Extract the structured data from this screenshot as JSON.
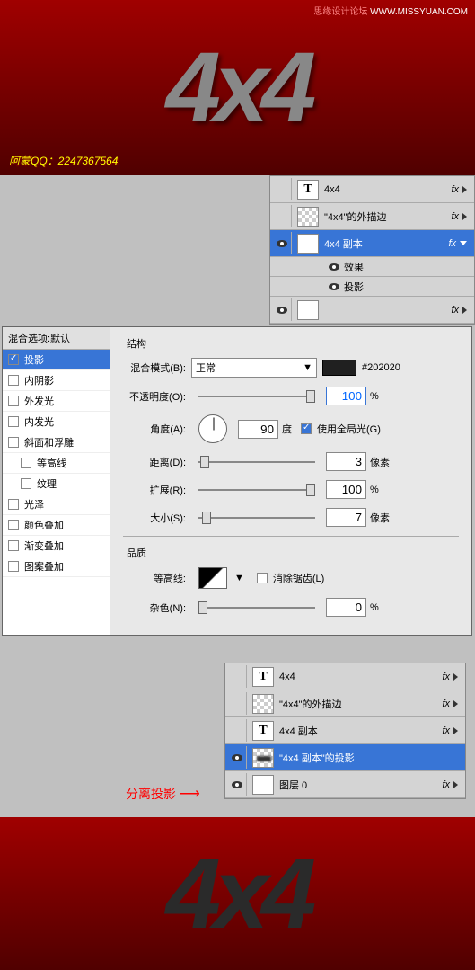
{
  "watermark": {
    "site1": "思缘设计论坛",
    "site2": "WWW.MISSYUAN.COM"
  },
  "qq": "阿蒙QQ：2247367564",
  "banner_text": "4x4",
  "layers_top": {
    "items": [
      {
        "name": "4x4",
        "type": "T",
        "fx": "fx"
      },
      {
        "name": "\"4x4\"的外描边",
        "type": "checker",
        "fx": "fx"
      },
      {
        "name": "4x4 副本",
        "type": "T",
        "fx": "fx",
        "selected": true,
        "visible": true
      },
      {
        "name": "效果",
        "sub": true,
        "visible": true
      },
      {
        "name": "投影",
        "sub": true,
        "visible": true
      },
      {
        "name": "",
        "type": "white",
        "fx": "fx",
        "visible": true
      }
    ]
  },
  "dialog": {
    "list_header": "混合选项:默认",
    "options": [
      "投影",
      "内阴影",
      "外发光",
      "内发光",
      "斜面和浮雕",
      "等高线",
      "纹理",
      "光泽",
      "颜色叠加",
      "渐变叠加",
      "图案叠加"
    ],
    "active_option": "投影",
    "section_structure": "结构",
    "blend_mode_label": "混合模式(B):",
    "blend_mode_value": "正常",
    "color_hex": "#202020",
    "opacity_label": "不透明度(O):",
    "opacity_value": "100",
    "angle_label": "角度(A):",
    "angle_value": "90",
    "angle_unit": "度",
    "global_light": "使用全局光(G)",
    "distance_label": "距离(D):",
    "distance_value": "3",
    "distance_unit": "像素",
    "spread_label": "扩展(R):",
    "spread_value": "100",
    "spread_unit": "%",
    "size_label": "大小(S):",
    "size_value": "7",
    "size_unit": "像素",
    "section_quality": "品质",
    "contour_label": "等高线:",
    "antialias": "消除锯齿(L)",
    "noise_label": "杂色(N):",
    "noise_value": "0",
    "noise_unit": "%",
    "percent": "%"
  },
  "annotation_text": "分离投影",
  "layers_bottom": {
    "items": [
      {
        "name": "4x4",
        "type": "T",
        "fx": "fx"
      },
      {
        "name": "\"4x4\"的外描边",
        "type": "checker",
        "fx": "fx"
      },
      {
        "name": "4x4 副本",
        "type": "T",
        "fx": "fx"
      },
      {
        "name": "\"4x4 副本\"的投影",
        "type": "shadow",
        "selected": true,
        "visible": true
      },
      {
        "name": "图层 0",
        "type": "white",
        "fx": "fx",
        "visible": true
      }
    ]
  }
}
